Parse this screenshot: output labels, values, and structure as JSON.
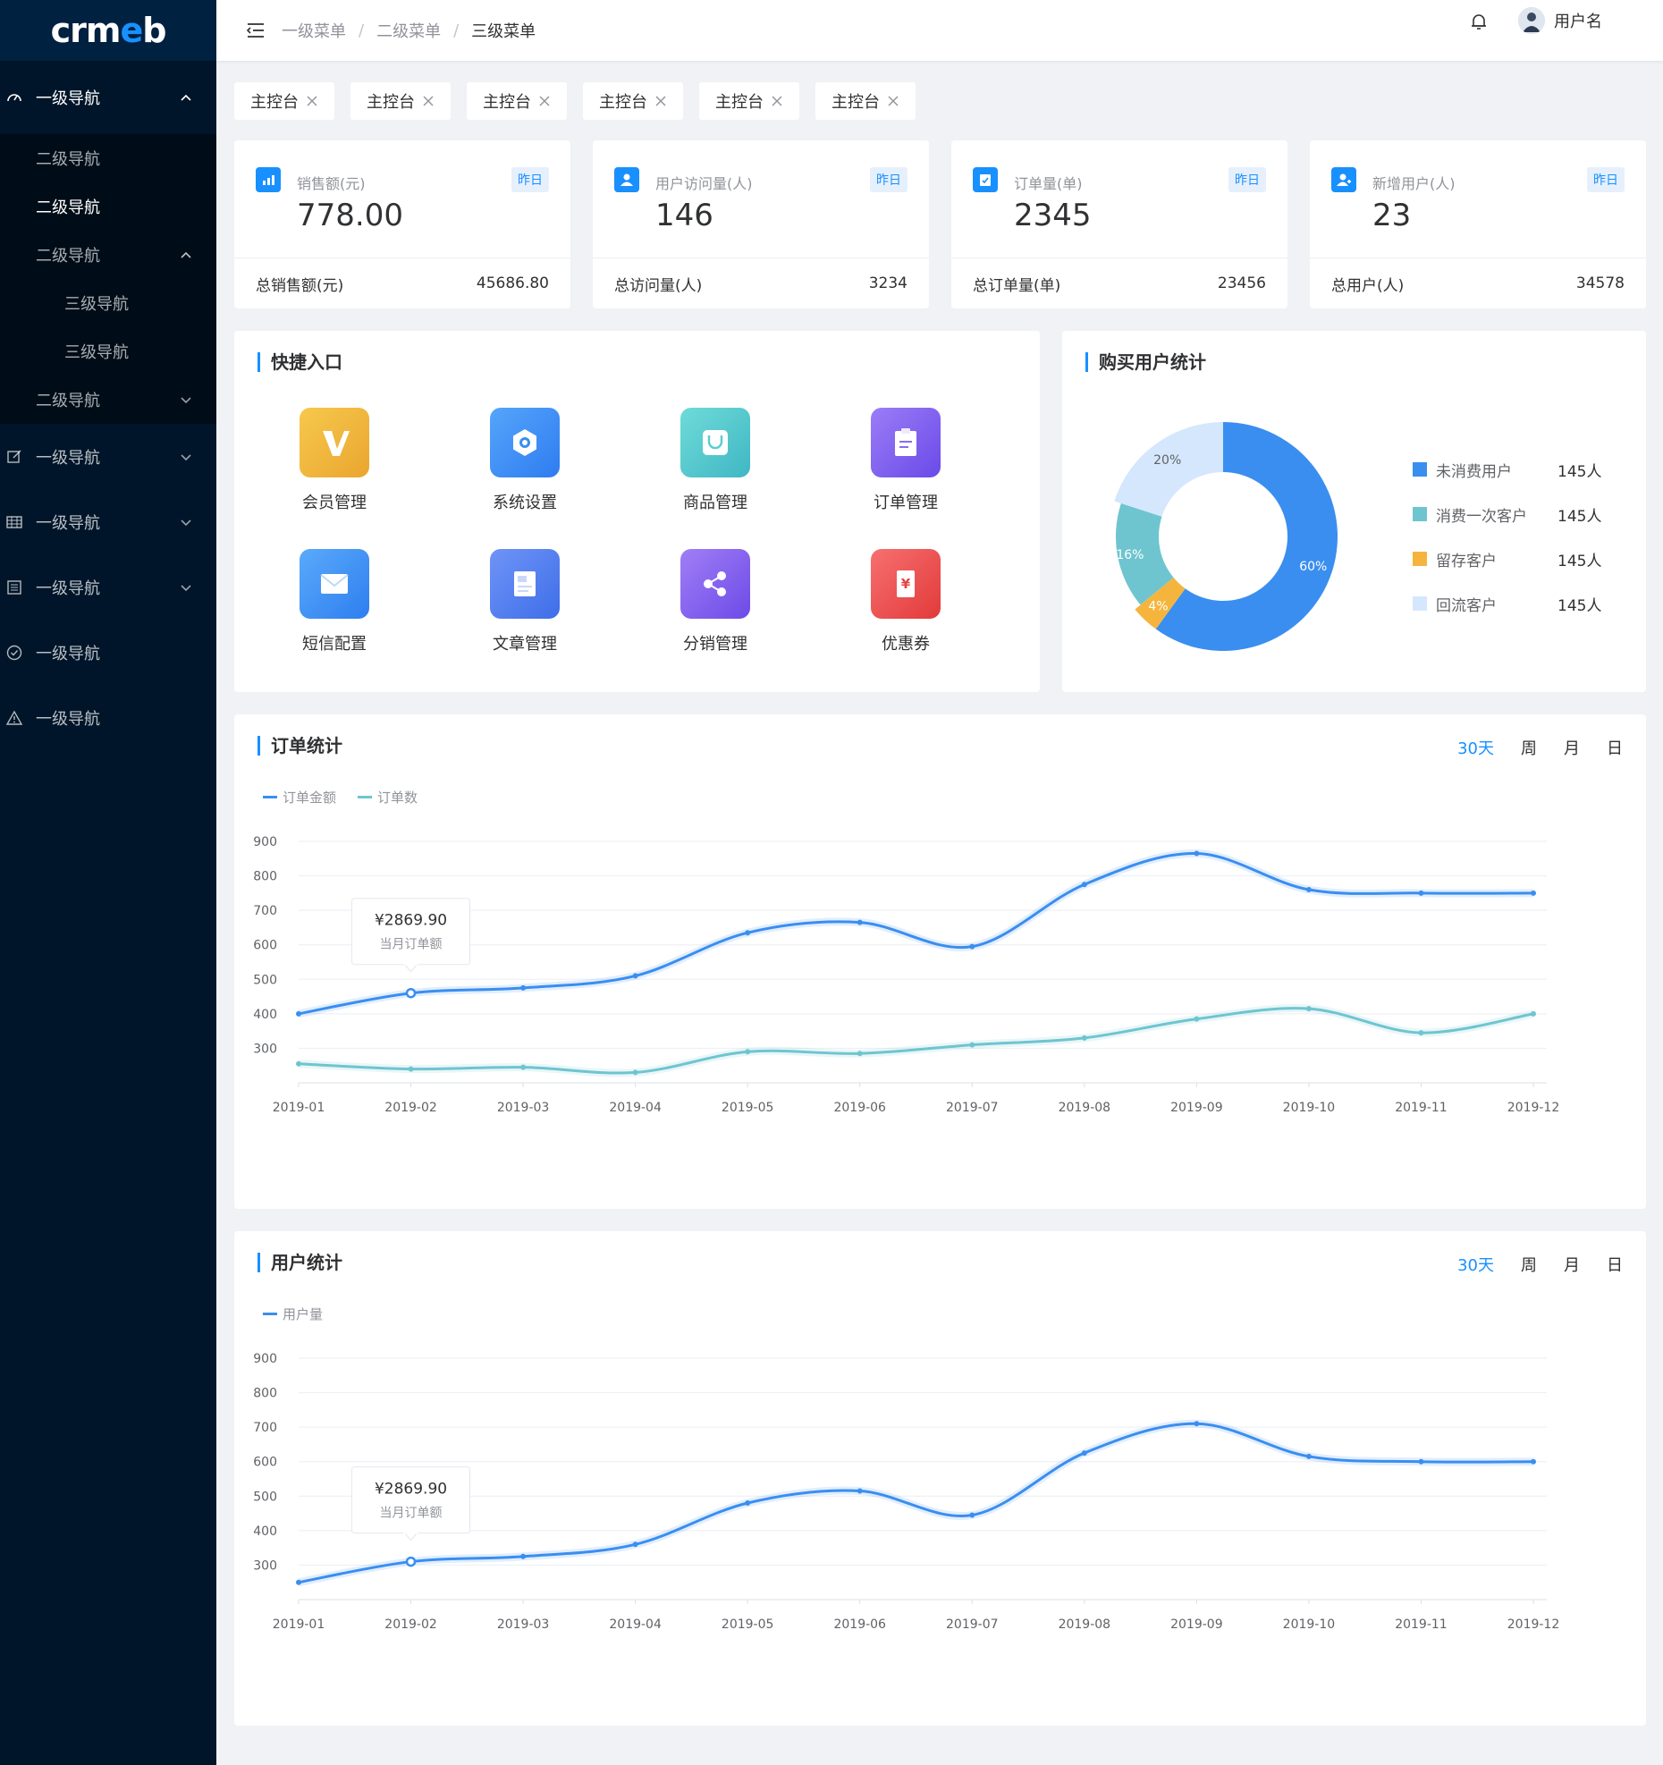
{
  "logo": "crmeb",
  "sidebar": {
    "items": [
      {
        "label": "一级导航",
        "open": true
      },
      {
        "label": "二级导航"
      },
      {
        "label": "二级导航",
        "active": true
      },
      {
        "label": "二级导航",
        "open": true
      },
      {
        "label": "三级导航"
      },
      {
        "label": "三级导航"
      },
      {
        "label": "二级导航"
      },
      {
        "label": "一级导航"
      },
      {
        "label": "一级导航"
      },
      {
        "label": "一级导航"
      },
      {
        "label": "一级导航"
      },
      {
        "label": "一级导航"
      }
    ]
  },
  "header": {
    "breadcrumb": [
      "一级菜单",
      "二级菜单",
      "三级菜单"
    ],
    "user_name": "用户名"
  },
  "tags": [
    "主控台",
    "主控台",
    "主控台",
    "主控台",
    "主控台",
    "主控台"
  ],
  "stats": [
    {
      "label": "销售额(元)",
      "badge": "昨日",
      "value": "778.00",
      "total_label": "总销售额(元)",
      "total_value": "45686.80"
    },
    {
      "label": "用户访问量(人)",
      "badge": "昨日",
      "value": "146",
      "total_label": "总访问量(人)",
      "total_value": "3234"
    },
    {
      "label": "订单量(单)",
      "badge": "昨日",
      "value": "2345",
      "total_label": "总订单量(单)",
      "total_value": "23456"
    },
    {
      "label": "新增用户(人)",
      "badge": "昨日",
      "value": "23",
      "total_label": "总用户(人)",
      "total_value": "34578"
    }
  ],
  "quick": {
    "title": "快捷入口",
    "items": [
      {
        "label": "会员管理",
        "icon": "member-icon",
        "color": "#f0b53c"
      },
      {
        "label": "系统设置",
        "icon": "settings-icon",
        "color": "#3e8ff5"
      },
      {
        "label": "商品管理",
        "icon": "bag-icon",
        "color": "#5cd0cf"
      },
      {
        "label": "订单管理",
        "icon": "order-icon",
        "color": "#7a5df0"
      },
      {
        "label": "短信配置",
        "icon": "mail-icon",
        "color": "#3f94f5"
      },
      {
        "label": "文章管理",
        "icon": "article-icon",
        "color": "#4a7cf0"
      },
      {
        "label": "分销管理",
        "icon": "share-icon",
        "color": "#8b5cf0"
      },
      {
        "label": "优惠券",
        "icon": "coupon-icon",
        "color": "#ef4b4b"
      }
    ]
  },
  "pie": {
    "title": "购买用户统计",
    "chart_data": {
      "type": "pie",
      "slices": [
        {
          "name": "未消费用户",
          "value": 60,
          "label": "60%",
          "color": "#3a8ef0",
          "count": "145人"
        },
        {
          "name": "消费一次客户",
          "value": 16,
          "label": "16%",
          "color": "#6ec5cf",
          "count": "145人"
        },
        {
          "name": "留存客户",
          "value": 4,
          "label": "4%",
          "color": "#f5b53d",
          "count": "145人"
        },
        {
          "name": "回流客户",
          "value": 20,
          "label": "20%",
          "color": "#d5e7fd",
          "count": "145人"
        }
      ]
    }
  },
  "order_chart": {
    "title": "订单统计",
    "tabs": [
      "30天",
      "周",
      "月",
      "日"
    ],
    "tooltip": {
      "value": "¥2869.90",
      "label": "当月订单额"
    },
    "chart_data": {
      "type": "line",
      "x": [
        "2019-01",
        "2019-02",
        "2019-03",
        "2019-04",
        "2019-05",
        "2019-06",
        "2019-07",
        "2019-08",
        "2019-09",
        "2019-10",
        "2019-11",
        "2019-12"
      ],
      "yticks": [
        300,
        400,
        500,
        600,
        700,
        800,
        900
      ],
      "ylim": [
        200,
        900
      ],
      "series": [
        {
          "name": "订单金额",
          "color": "#3a8ef0",
          "values": [
            400,
            460,
            475,
            510,
            635,
            665,
            595,
            775,
            865,
            760,
            750,
            750
          ]
        },
        {
          "name": "订单数",
          "color": "#6ec5cf",
          "values": [
            255,
            240,
            245,
            230,
            290,
            285,
            310,
            330,
            385,
            415,
            345,
            400
          ]
        }
      ]
    }
  },
  "user_chart": {
    "title": "用户统计",
    "tabs": [
      "30天",
      "周",
      "月",
      "日"
    ],
    "tooltip": {
      "value": "¥2869.90",
      "label": "当月订单额"
    },
    "chart_data": {
      "type": "line",
      "x": [
        "2019-01",
        "2019-02",
        "2019-03",
        "2019-04",
        "2019-05",
        "2019-06",
        "2019-07",
        "2019-08",
        "2019-09",
        "2019-10",
        "2019-11",
        "2019-12"
      ],
      "yticks": [
        300,
        400,
        500,
        600,
        700,
        800,
        900
      ],
      "ylim": [
        200,
        900
      ],
      "series": [
        {
          "name": "用户量",
          "color": "#3a8ef0",
          "values": [
            250,
            310,
            325,
            360,
            480,
            515,
            445,
            625,
            710,
            615,
            600,
            600
          ]
        }
      ]
    }
  }
}
